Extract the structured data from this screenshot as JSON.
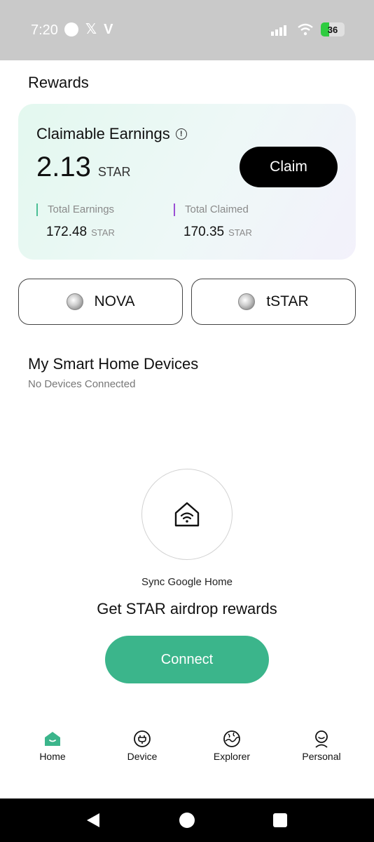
{
  "status_bar": {
    "time": "7:20",
    "battery": "36",
    "battery_level": 0.36
  },
  "page_title": "Rewards",
  "earnings": {
    "title": "Claimable Earnings",
    "claimable_value": "2.13",
    "claimable_unit": "STAR",
    "claim_label": "Claim",
    "total_earnings_label": "Total Earnings",
    "total_earnings_value": "172.48",
    "total_earnings_unit": "STAR",
    "total_claimed_label": "Total Claimed",
    "total_claimed_value": "170.35",
    "total_claimed_unit": "STAR"
  },
  "tokens": [
    {
      "label": "NOVA",
      "icon": "nova-token-icon"
    },
    {
      "label": "tSTAR",
      "icon": "tstar-token-icon"
    }
  ],
  "devices": {
    "title": "My Smart Home Devices",
    "subtitle": "No Devices Connected",
    "sync_text": "Sync Google Home",
    "airdrop_text": "Get STAR airdrop rewards",
    "connect_label": "Connect"
  },
  "nav": [
    {
      "label": "Home",
      "icon": "home-icon",
      "active": true
    },
    {
      "label": "Device",
      "icon": "plug-icon"
    },
    {
      "label": "Explorer",
      "icon": "globe-icon"
    },
    {
      "label": "Personal",
      "icon": "person-icon"
    }
  ],
  "colors": {
    "accent": "#3bb58b",
    "claim_bg": "#000000",
    "purple": "#9b4fd4"
  }
}
